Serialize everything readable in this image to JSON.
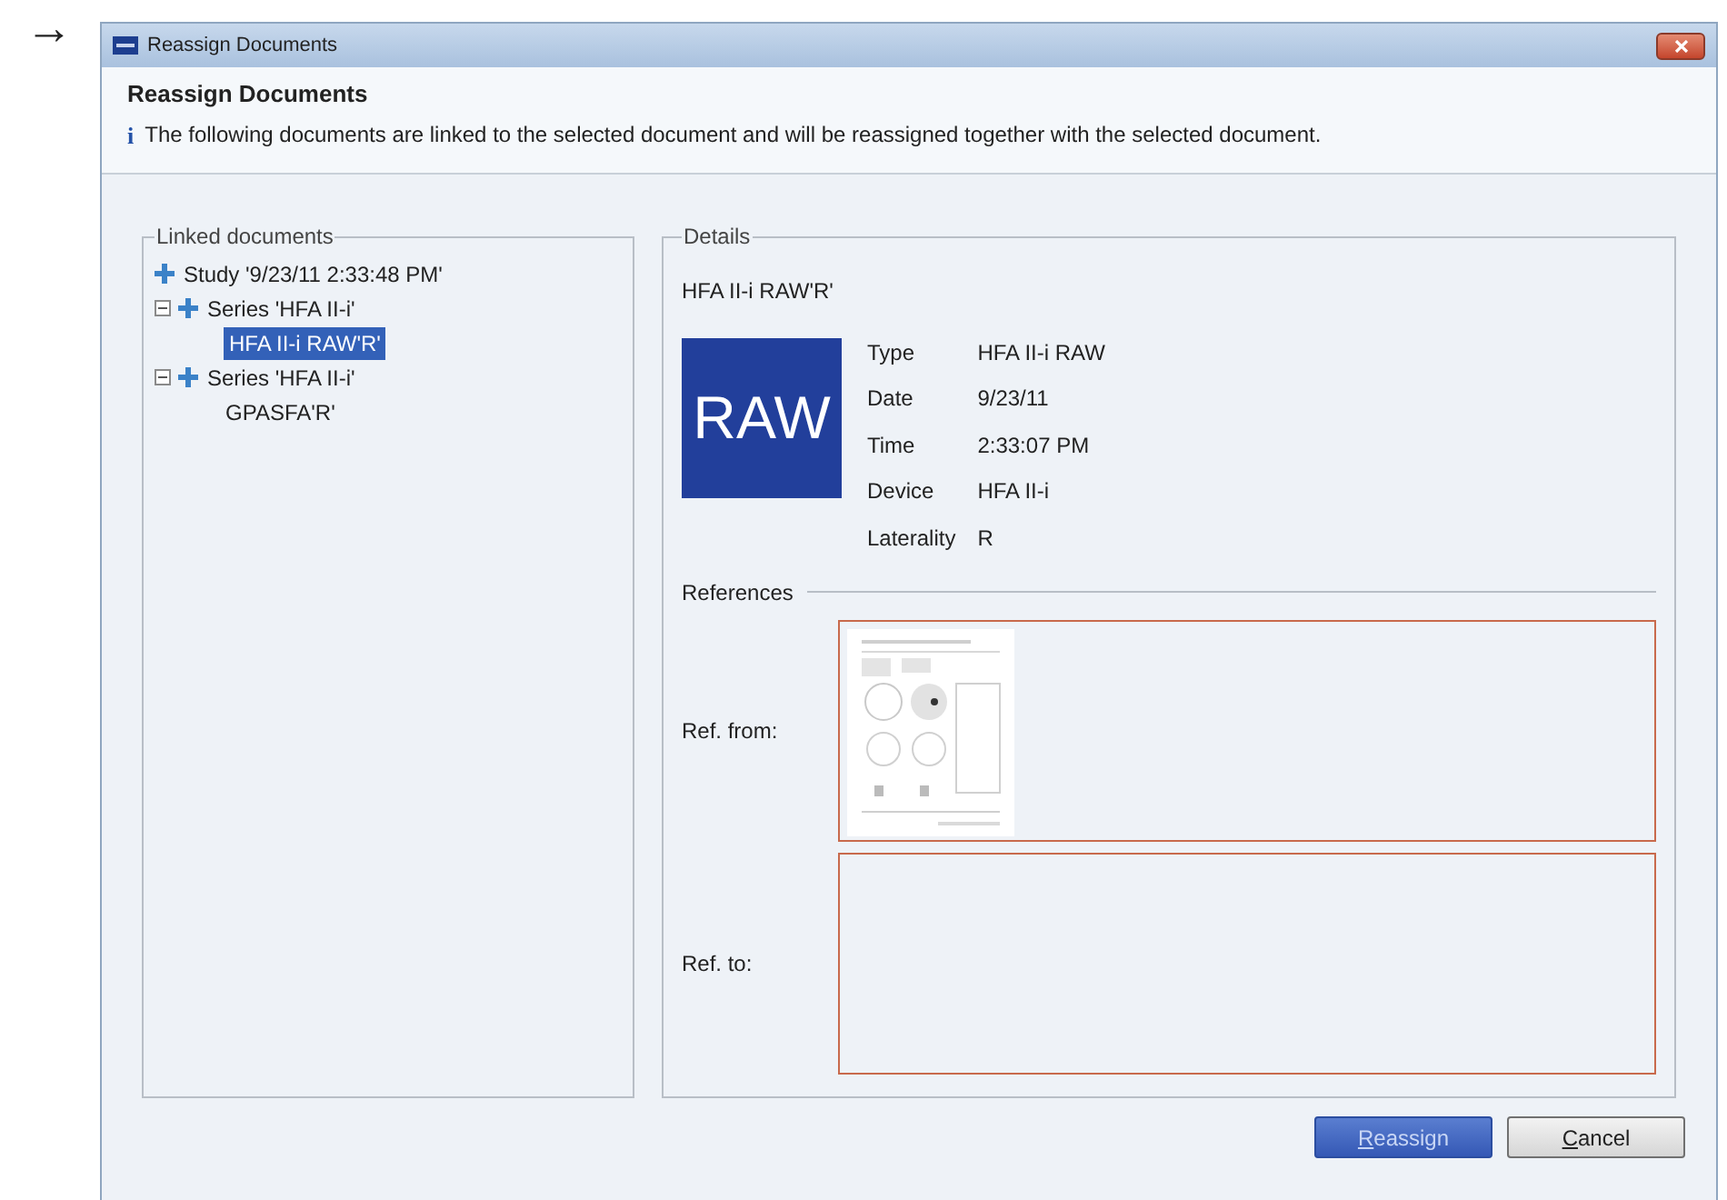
{
  "pointer_arrow": "→",
  "window": {
    "title": "Reassign Documents"
  },
  "header": {
    "title": "Reassign Documents",
    "info_icon": "i",
    "message": "The following documents are linked to the selected document and will be reassigned together with the selected document."
  },
  "linked_documents": {
    "legend": "Linked documents",
    "items": [
      {
        "kind": "study",
        "label": "Study '9/23/11  2:33:48 PM'",
        "selected": false
      },
      {
        "kind": "series",
        "label": "Series 'HFA II-i'",
        "selected": false,
        "expanded": true,
        "children": [
          {
            "kind": "document",
            "label": "HFA II-i RAW'R'",
            "selected": true
          }
        ]
      },
      {
        "kind": "series",
        "label": "Series 'HFA II-i'",
        "selected": false,
        "expanded": true,
        "children": [
          {
            "kind": "document",
            "label": "GPASFA'R'",
            "selected": false
          }
        ]
      }
    ]
  },
  "details": {
    "legend": "Details",
    "name": "HFA II-i RAW'R'",
    "badge": "RAW",
    "fields": [
      {
        "label": "Type",
        "value": "HFA II-i RAW"
      },
      {
        "label": "Date",
        "value": "9/23/11"
      },
      {
        "label": "Time",
        "value": "2:33:07 PM"
      },
      {
        "label": "Device",
        "value": "HFA II-i"
      },
      {
        "label": "Laterality",
        "value": "R"
      }
    ],
    "references": {
      "title": "References",
      "ref_from": {
        "label": "Ref. from:"
      },
      "ref_to": {
        "label": "Ref. to:"
      }
    }
  },
  "buttons": [
    {
      "label": "Reassign",
      "primary": true,
      "access_key_underlined": true
    },
    {
      "label": "Cancel",
      "primary": false,
      "access_key_underlined": true
    }
  ]
}
